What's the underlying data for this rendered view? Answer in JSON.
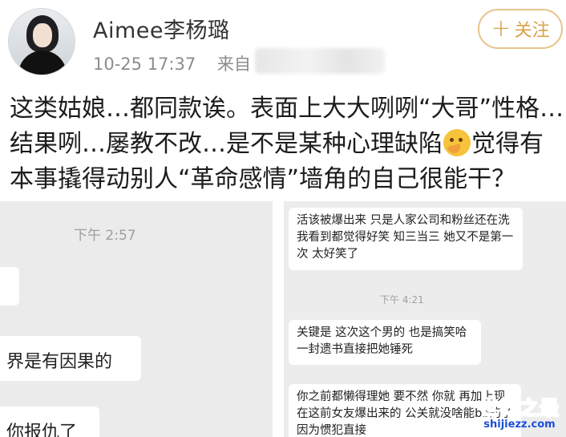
{
  "post": {
    "username": "Aimee李杨璐",
    "timestamp": "10-25 17:37",
    "source_prefix": "来自",
    "follow_label": "关注",
    "text_lines": [
      "这类姑娘…都同款诶。表面上大大咧咧“大哥”性格…",
      "结果咧…屡教不改…是不是某种心理缺陷",
      "觉得有",
      "本事撬得动别人“革命感情”墙角的自己很能干？"
    ]
  },
  "left_screenshot": {
    "time": "下午 2:57",
    "messages": [
      "界是有因果的",
      "你报仇了"
    ]
  },
  "right_screenshot": {
    "time": "下午 4:21",
    "messages": [
      "活该被爆出来 只是人家公司和粉丝还在洗 我看到都觉得好笑 知三当三 她又不是第一次 太好笑了",
      "关键是 这次这个男的 也是搞笑哈 一封遗书直接把她锤死",
      "你之前都懒得理她 要不然 你就 再加上现在这前女友爆出来的 公关就没啥能bb的了 因为惯犯直接"
    ]
  },
  "watermark": {
    "title": "世界之最",
    "url": "shijiezz.com"
  },
  "icons": {
    "follow": "plus-icon",
    "emoji": "thinking-face-icon"
  },
  "colors": {
    "follow_accent": "#d9a24a",
    "watermark": "#1a4fd6"
  }
}
